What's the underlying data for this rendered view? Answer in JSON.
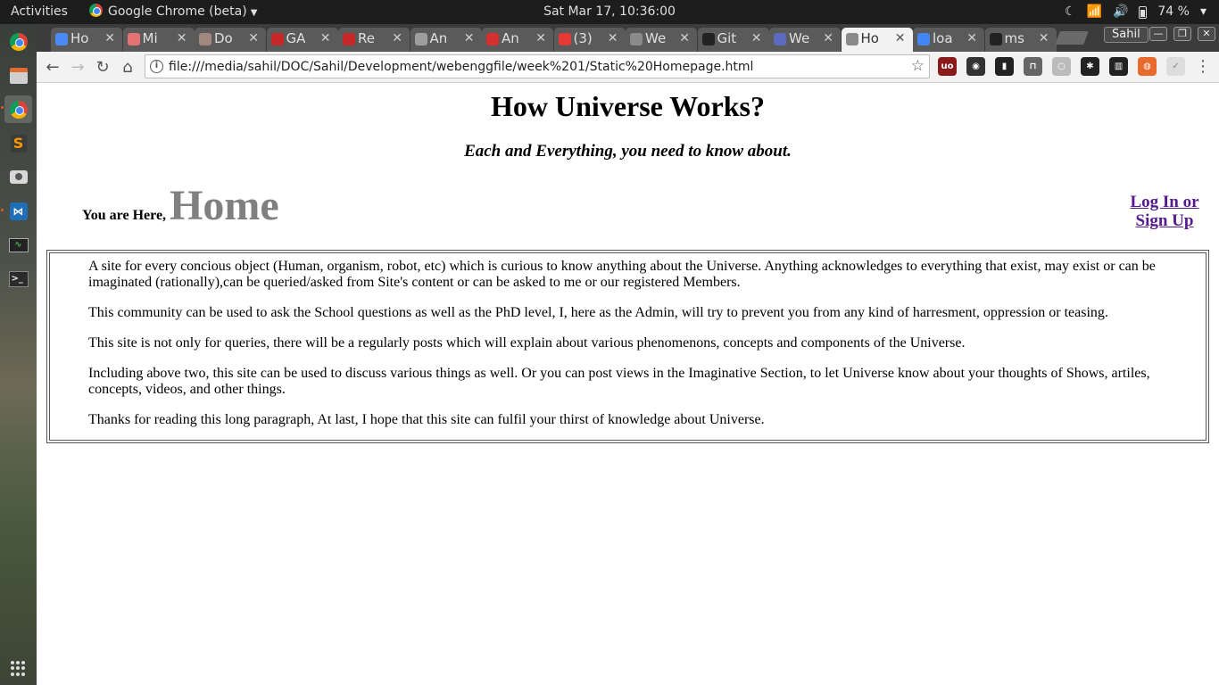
{
  "desktop": {
    "activities": "Activities",
    "app_name": "Google Chrome (beta)",
    "clock": "Sat Mar 17, 10:36:00",
    "battery": "74 %"
  },
  "browser": {
    "tabs": [
      {
        "label": "Ho",
        "favicon": "google-docs-icon",
        "color": "#4a8af4"
      },
      {
        "label": "Mi",
        "favicon": "target-icon",
        "color": "#e57373"
      },
      {
        "label": "Do",
        "favicon": "face-icon",
        "color": "#a1887f"
      },
      {
        "label": "GA",
        "favicon": "ne-logo-icon",
        "color": "#c62828"
      },
      {
        "label": "Re",
        "favicon": "ne-logo-icon",
        "color": "#c62828"
      },
      {
        "label": "An",
        "favicon": "gear-icon",
        "color": "#9e9e9e"
      },
      {
        "label": "An",
        "favicon": "angular-icon",
        "color": "#d32f2f"
      },
      {
        "label": "(3)",
        "favicon": "youtube-icon",
        "color": "#e53935"
      },
      {
        "label": "We",
        "favicon": "page-icon",
        "color": "#8a8a8a"
      },
      {
        "label": "Git",
        "favicon": "github-icon",
        "color": "#222222"
      },
      {
        "label": "We",
        "favicon": "doc-lines-icon",
        "color": "#5c6bc0"
      },
      {
        "label": "Ho",
        "favicon": "page-icon",
        "color": "#8a8a8a"
      },
      {
        "label": "loa",
        "favicon": "google-icon",
        "color": "#4285f4"
      },
      {
        "label": "ms",
        "favicon": "github-icon",
        "color": "#222222"
      }
    ],
    "active_tab_index": 11,
    "profile": "Sahil",
    "url": "file:///media/sahil/DOC/Sahil/Development/webenggfile/week%201/Static%20Homepage.html"
  },
  "page": {
    "title": "How Universe Works?",
    "tagline": "Each and Everything, you need to know about.",
    "location_prefix": "You are Here,",
    "location_page": "Home",
    "auth_link_line1": "Log In or",
    "auth_link_line2": "Sign Up",
    "link_color": "#551a8b",
    "paragraphs": [
      "A site for every concious object (Human, organism, robot, etc) which is curious to know anything about the Universe. Anything acknowledges to everything that exist, may exist or can be imaginated (rationally),can be queried/asked from Site's content or can be asked to me or our registered Members.",
      "This community can be used to ask the School questions as well as the PhD level, I, here as the Admin, will try to prevent you from any kind of harresment, oppression or teasing.",
      "This site is not only for queries, there will be a regularly posts which will explain about various phenomenons, concepts and components of the Universe.",
      "Including above two, this site can be used to discuss various things as well. Or you can post views in the Imaginative Section, to let Universe know about your thoughts of Shows, artiles, concepts, videos, and other things.",
      "Thanks for reading this long paragraph, At last, I hope that this site can fulfil your thirst of knowledge about Universe."
    ]
  }
}
